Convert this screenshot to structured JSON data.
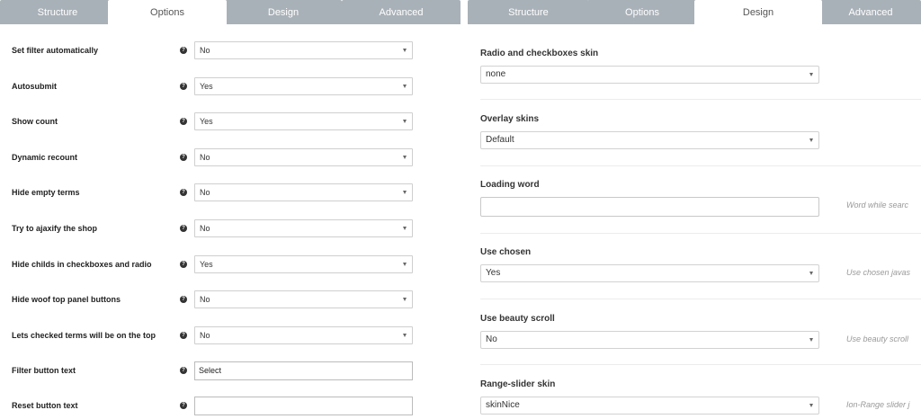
{
  "left": {
    "tabs": [
      "Structure",
      "Options",
      "Design",
      "Advanced"
    ],
    "active_tab": "Options",
    "options": [
      {
        "label": "Set filter automatically",
        "type": "select",
        "value": "No"
      },
      {
        "label": "Autosubmit",
        "type": "select",
        "value": "Yes"
      },
      {
        "label": "Show count",
        "type": "select",
        "value": "Yes"
      },
      {
        "label": "Dynamic recount",
        "type": "select",
        "value": "No"
      },
      {
        "label": "Hide empty terms",
        "type": "select",
        "value": "No"
      },
      {
        "label": "Try to ajaxify the shop",
        "type": "select",
        "value": "No"
      },
      {
        "label": "Hide childs in checkboxes and radio",
        "type": "select",
        "value": "Yes"
      },
      {
        "label": "Hide woof top panel buttons",
        "type": "select",
        "value": "No"
      },
      {
        "label": "Lets checked terms will be on the top",
        "type": "select",
        "value": "No"
      },
      {
        "label": "Filter button text",
        "type": "text",
        "value": "Select"
      },
      {
        "label": "Reset button text",
        "type": "text",
        "value": ""
      }
    ],
    "help_icon": "?"
  },
  "right": {
    "tabs": [
      "Structure",
      "Options",
      "Design",
      "Advanced"
    ],
    "active_tab": "Design",
    "sections": [
      {
        "title": "Radio and checkboxes skin",
        "type": "select",
        "value": "none",
        "hint": ""
      },
      {
        "title": "Overlay skins",
        "type": "select",
        "value": "Default",
        "hint": ""
      },
      {
        "title": "Loading word",
        "type": "text",
        "value": "",
        "hint": "Word while searc"
      },
      {
        "title": "Use chosen",
        "type": "select",
        "value": "Yes",
        "hint": "Use chosen javas"
      },
      {
        "title": "Use beauty scroll",
        "type": "select",
        "value": "No",
        "hint": "Use beauty scroll"
      },
      {
        "title": "Range-slider skin",
        "type": "select",
        "value": "skinNice",
        "hint": "Ion-Range slider j"
      }
    ]
  },
  "colors": {
    "tab_inactive": "#a9b1b8",
    "tab_active": "#ffffff",
    "text_dark": "#222222",
    "hint_text": "#999999"
  }
}
